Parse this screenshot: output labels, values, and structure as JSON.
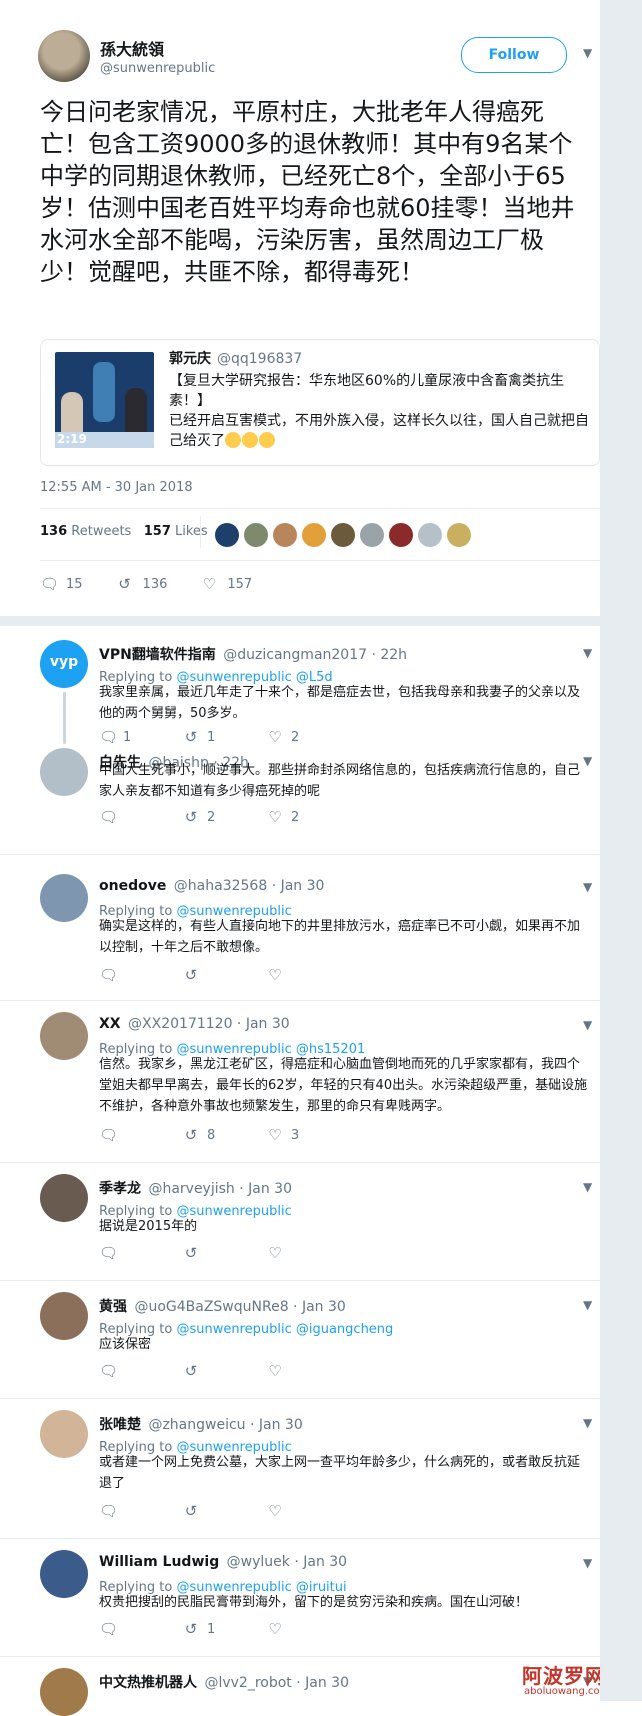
{
  "tweet": {
    "author_name": "孫大統領",
    "author_handle": "@sunwenrepublic",
    "follow_label": "Follow",
    "text": "今日问老家情况，平原村庄，大批老年人得癌死亡！包含工资9000多的退休教师！其中有9名某个中学的同期退休教师，已经死亡8个，全部小于65岁！估测中国老百姓平均寿命也就60挂零！当地井水河水全部不能喝，污染厉害，虽然周边工厂极少！觉醒吧，共匪不除，都得毒死！",
    "quote": {
      "name": "郭元庆",
      "handle": "@qq196837",
      "text": "【复旦大学研究报告：华东地区60%的儿童尿液中含畜禽类抗生素！】\n已经开启互害模式，不用外族入侵，这样长久以往，国人自己就把自己给灭了",
      "image_clock": "2:19"
    },
    "timestamp": "12:55 AM - 30 Jan 2018",
    "retweets_count": "136",
    "retweets_label": "Retweets",
    "likes_count": "157",
    "likes_label": "Likes",
    "actions": {
      "reply": "15",
      "retweet": "136",
      "like": "157"
    }
  },
  "icons": {
    "reply": "reply-icon",
    "retweet": "retweet-icon",
    "like": "heart-icon",
    "menu": "chevron-down-icon"
  },
  "colors": {
    "accent": "#1da1f2",
    "muted": "#657786",
    "divider": "#e6ecf0",
    "watermark": "#c4352b"
  },
  "replies": [
    {
      "name": "VPN翻墙软件指南",
      "handle": "@duzicangman2017 · 22h",
      "replying_prefix": "Replying to ",
      "replying_to": "@sunwenrepublic @L5d",
      "text": "我家里亲属，最近几年走了十来个，都是癌症去世，包括我母亲和我妻子的父亲以及他的两个舅舅，50多岁。",
      "reply": "1",
      "retweet": "1",
      "like": "2",
      "avatar_text": "vyp"
    },
    {
      "name": "白先生",
      "handle": "@baishp · 22h",
      "replying_prefix": "",
      "replying_to": "",
      "text": "中国人生死事小，顺逆事大。那些拼命封杀网络信息的，包括疾病流行信息的，自己家人亲友都不知道有多少得癌死掉的呢",
      "reply": "",
      "retweet": "2",
      "like": "2",
      "avatar_text": ""
    },
    {
      "name": "onedove",
      "handle": "@haha32568 · Jan 30",
      "replying_prefix": "Replying to ",
      "replying_to": "@sunwenrepublic",
      "text": "确实是这样的，有些人直接向地下的井里排放污水，癌症率已不可小觑，如果再不加以控制，十年之后不敢想像。",
      "reply": "",
      "retweet": "",
      "like": "",
      "avatar_text": ""
    },
    {
      "name": "XX",
      "handle": "@XX20171120 · Jan 30",
      "replying_prefix": "Replying to ",
      "replying_to": "@sunwenrepublic @hs15201",
      "text": "信然。我家乡，黑龙江老矿区，得癌症和心脑血管倒地而死的几乎家家都有，我四个堂姐夫都早早离去，最年长的62岁，年轻的只有40出头。水污染超级严重，基础设施不维护，各种意外事故也频繁发生，那里的命只有卑贱两字。",
      "reply": "",
      "retweet": "8",
      "like": "3",
      "avatar_text": ""
    },
    {
      "name": "季孝龙",
      "handle": "@harveyjish · Jan 30",
      "replying_prefix": "Replying to ",
      "replying_to": "@sunwenrepublic",
      "text": "据说是2015年的",
      "reply": "",
      "retweet": "",
      "like": "",
      "avatar_text": ""
    },
    {
      "name": "黄强",
      "handle": "@uoG4BaZSwquNRe8 · Jan 30",
      "replying_prefix": "Replying to ",
      "replying_to": "@sunwenrepublic @iguangcheng",
      "text": "应该保密",
      "reply": "",
      "retweet": "",
      "like": "",
      "avatar_text": ""
    },
    {
      "name": "张唯楚",
      "handle": "@zhangweicu · Jan 30",
      "replying_prefix": "Replying to ",
      "replying_to": "@sunwenrepublic",
      "text": "或者建一个网上免费公墓，大家上网一查平均年龄多少，什么病死的，或者敢反抗延退了",
      "reply": "",
      "retweet": "",
      "like": "",
      "avatar_text": ""
    },
    {
      "name": "William Ludwig",
      "handle": "@wyluek · Jan 30",
      "replying_prefix": "Replying to ",
      "replying_to": "@sunwenrepublic @iruitui",
      "text": "权贵把搜刮的民脂民膏带到海外，留下的是贫穷污染和疾病。国在山河破！",
      "reply": "",
      "retweet": "1",
      "like": "",
      "avatar_text": ""
    },
    {
      "name": "中文热推机器人",
      "handle": "@lvv2_robot · Jan 30",
      "replying_prefix": "",
      "replying_to": "",
      "text": "",
      "reply": "",
      "retweet": "",
      "like": "",
      "avatar_text": ""
    }
  ],
  "watermark": {
    "text_cn": "阿波罗网",
    "text_en": "aboluowang.com"
  }
}
